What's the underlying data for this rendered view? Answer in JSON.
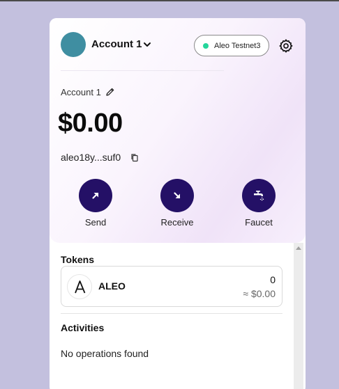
{
  "header": {
    "account_name": "Account 1",
    "network": "Aleo Testnet3",
    "network_status_color": "#25d69b",
    "avatar_color": "#3f8ea1",
    "icons": {
      "chevron": "chevron-down-icon",
      "settings": "gear-icon"
    }
  },
  "account": {
    "label": "Account 1",
    "balance": "$0.00",
    "address": "aleo18y...suf0",
    "icons": {
      "edit": "pencil-icon",
      "copy": "copy-icon"
    }
  },
  "actions": [
    {
      "label": "Send",
      "icon": "arrow-up-right-icon"
    },
    {
      "label": "Receive",
      "icon": "arrow-down-right-icon"
    },
    {
      "label": "Faucet",
      "icon": "faucet-icon"
    }
  ],
  "accent_color": "#241066",
  "tokens": {
    "title": "Tokens",
    "items": [
      {
        "symbol": "ALEO",
        "amount": "0",
        "usd": "≈ $0.00",
        "icon": "aleo-logo-icon"
      }
    ]
  },
  "activities": {
    "title": "Activities",
    "empty_text": "No operations found"
  }
}
